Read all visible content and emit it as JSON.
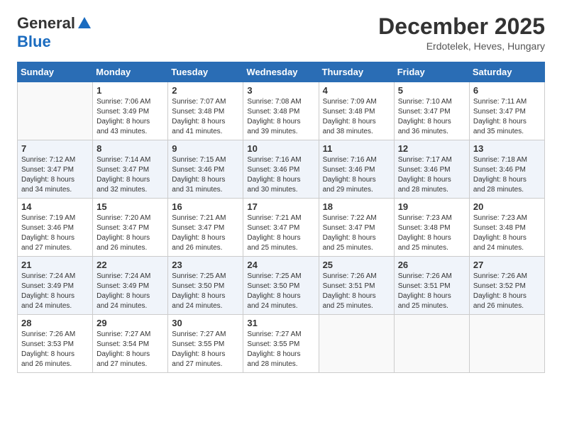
{
  "header": {
    "logo_general": "General",
    "logo_blue": "Blue",
    "month_title": "December 2025",
    "subtitle": "Erdotelek, Heves, Hungary"
  },
  "weekdays": [
    "Sunday",
    "Monday",
    "Tuesday",
    "Wednesday",
    "Thursday",
    "Friday",
    "Saturday"
  ],
  "weeks": [
    [
      {
        "day": "",
        "info": ""
      },
      {
        "day": "1",
        "info": "Sunrise: 7:06 AM\nSunset: 3:49 PM\nDaylight: 8 hours\nand 43 minutes."
      },
      {
        "day": "2",
        "info": "Sunrise: 7:07 AM\nSunset: 3:48 PM\nDaylight: 8 hours\nand 41 minutes."
      },
      {
        "day": "3",
        "info": "Sunrise: 7:08 AM\nSunset: 3:48 PM\nDaylight: 8 hours\nand 39 minutes."
      },
      {
        "day": "4",
        "info": "Sunrise: 7:09 AM\nSunset: 3:48 PM\nDaylight: 8 hours\nand 38 minutes."
      },
      {
        "day": "5",
        "info": "Sunrise: 7:10 AM\nSunset: 3:47 PM\nDaylight: 8 hours\nand 36 minutes."
      },
      {
        "day": "6",
        "info": "Sunrise: 7:11 AM\nSunset: 3:47 PM\nDaylight: 8 hours\nand 35 minutes."
      }
    ],
    [
      {
        "day": "7",
        "info": "Sunrise: 7:12 AM\nSunset: 3:47 PM\nDaylight: 8 hours\nand 34 minutes."
      },
      {
        "day": "8",
        "info": "Sunrise: 7:14 AM\nSunset: 3:47 PM\nDaylight: 8 hours\nand 32 minutes."
      },
      {
        "day": "9",
        "info": "Sunrise: 7:15 AM\nSunset: 3:46 PM\nDaylight: 8 hours\nand 31 minutes."
      },
      {
        "day": "10",
        "info": "Sunrise: 7:16 AM\nSunset: 3:46 PM\nDaylight: 8 hours\nand 30 minutes."
      },
      {
        "day": "11",
        "info": "Sunrise: 7:16 AM\nSunset: 3:46 PM\nDaylight: 8 hours\nand 29 minutes."
      },
      {
        "day": "12",
        "info": "Sunrise: 7:17 AM\nSunset: 3:46 PM\nDaylight: 8 hours\nand 28 minutes."
      },
      {
        "day": "13",
        "info": "Sunrise: 7:18 AM\nSunset: 3:46 PM\nDaylight: 8 hours\nand 28 minutes."
      }
    ],
    [
      {
        "day": "14",
        "info": "Sunrise: 7:19 AM\nSunset: 3:46 PM\nDaylight: 8 hours\nand 27 minutes."
      },
      {
        "day": "15",
        "info": "Sunrise: 7:20 AM\nSunset: 3:47 PM\nDaylight: 8 hours\nand 26 minutes."
      },
      {
        "day": "16",
        "info": "Sunrise: 7:21 AM\nSunset: 3:47 PM\nDaylight: 8 hours\nand 26 minutes."
      },
      {
        "day": "17",
        "info": "Sunrise: 7:21 AM\nSunset: 3:47 PM\nDaylight: 8 hours\nand 25 minutes."
      },
      {
        "day": "18",
        "info": "Sunrise: 7:22 AM\nSunset: 3:47 PM\nDaylight: 8 hours\nand 25 minutes."
      },
      {
        "day": "19",
        "info": "Sunrise: 7:23 AM\nSunset: 3:48 PM\nDaylight: 8 hours\nand 25 minutes."
      },
      {
        "day": "20",
        "info": "Sunrise: 7:23 AM\nSunset: 3:48 PM\nDaylight: 8 hours\nand 24 minutes."
      }
    ],
    [
      {
        "day": "21",
        "info": "Sunrise: 7:24 AM\nSunset: 3:49 PM\nDaylight: 8 hours\nand 24 minutes."
      },
      {
        "day": "22",
        "info": "Sunrise: 7:24 AM\nSunset: 3:49 PM\nDaylight: 8 hours\nand 24 minutes."
      },
      {
        "day": "23",
        "info": "Sunrise: 7:25 AM\nSunset: 3:50 PM\nDaylight: 8 hours\nand 24 minutes."
      },
      {
        "day": "24",
        "info": "Sunrise: 7:25 AM\nSunset: 3:50 PM\nDaylight: 8 hours\nand 24 minutes."
      },
      {
        "day": "25",
        "info": "Sunrise: 7:26 AM\nSunset: 3:51 PM\nDaylight: 8 hours\nand 25 minutes."
      },
      {
        "day": "26",
        "info": "Sunrise: 7:26 AM\nSunset: 3:51 PM\nDaylight: 8 hours\nand 25 minutes."
      },
      {
        "day": "27",
        "info": "Sunrise: 7:26 AM\nSunset: 3:52 PM\nDaylight: 8 hours\nand 26 minutes."
      }
    ],
    [
      {
        "day": "28",
        "info": "Sunrise: 7:26 AM\nSunset: 3:53 PM\nDaylight: 8 hours\nand 26 minutes."
      },
      {
        "day": "29",
        "info": "Sunrise: 7:27 AM\nSunset: 3:54 PM\nDaylight: 8 hours\nand 27 minutes."
      },
      {
        "day": "30",
        "info": "Sunrise: 7:27 AM\nSunset: 3:55 PM\nDaylight: 8 hours\nand 27 minutes."
      },
      {
        "day": "31",
        "info": "Sunrise: 7:27 AM\nSunset: 3:55 PM\nDaylight: 8 hours\nand 28 minutes."
      },
      {
        "day": "",
        "info": ""
      },
      {
        "day": "",
        "info": ""
      },
      {
        "day": "",
        "info": ""
      }
    ]
  ]
}
